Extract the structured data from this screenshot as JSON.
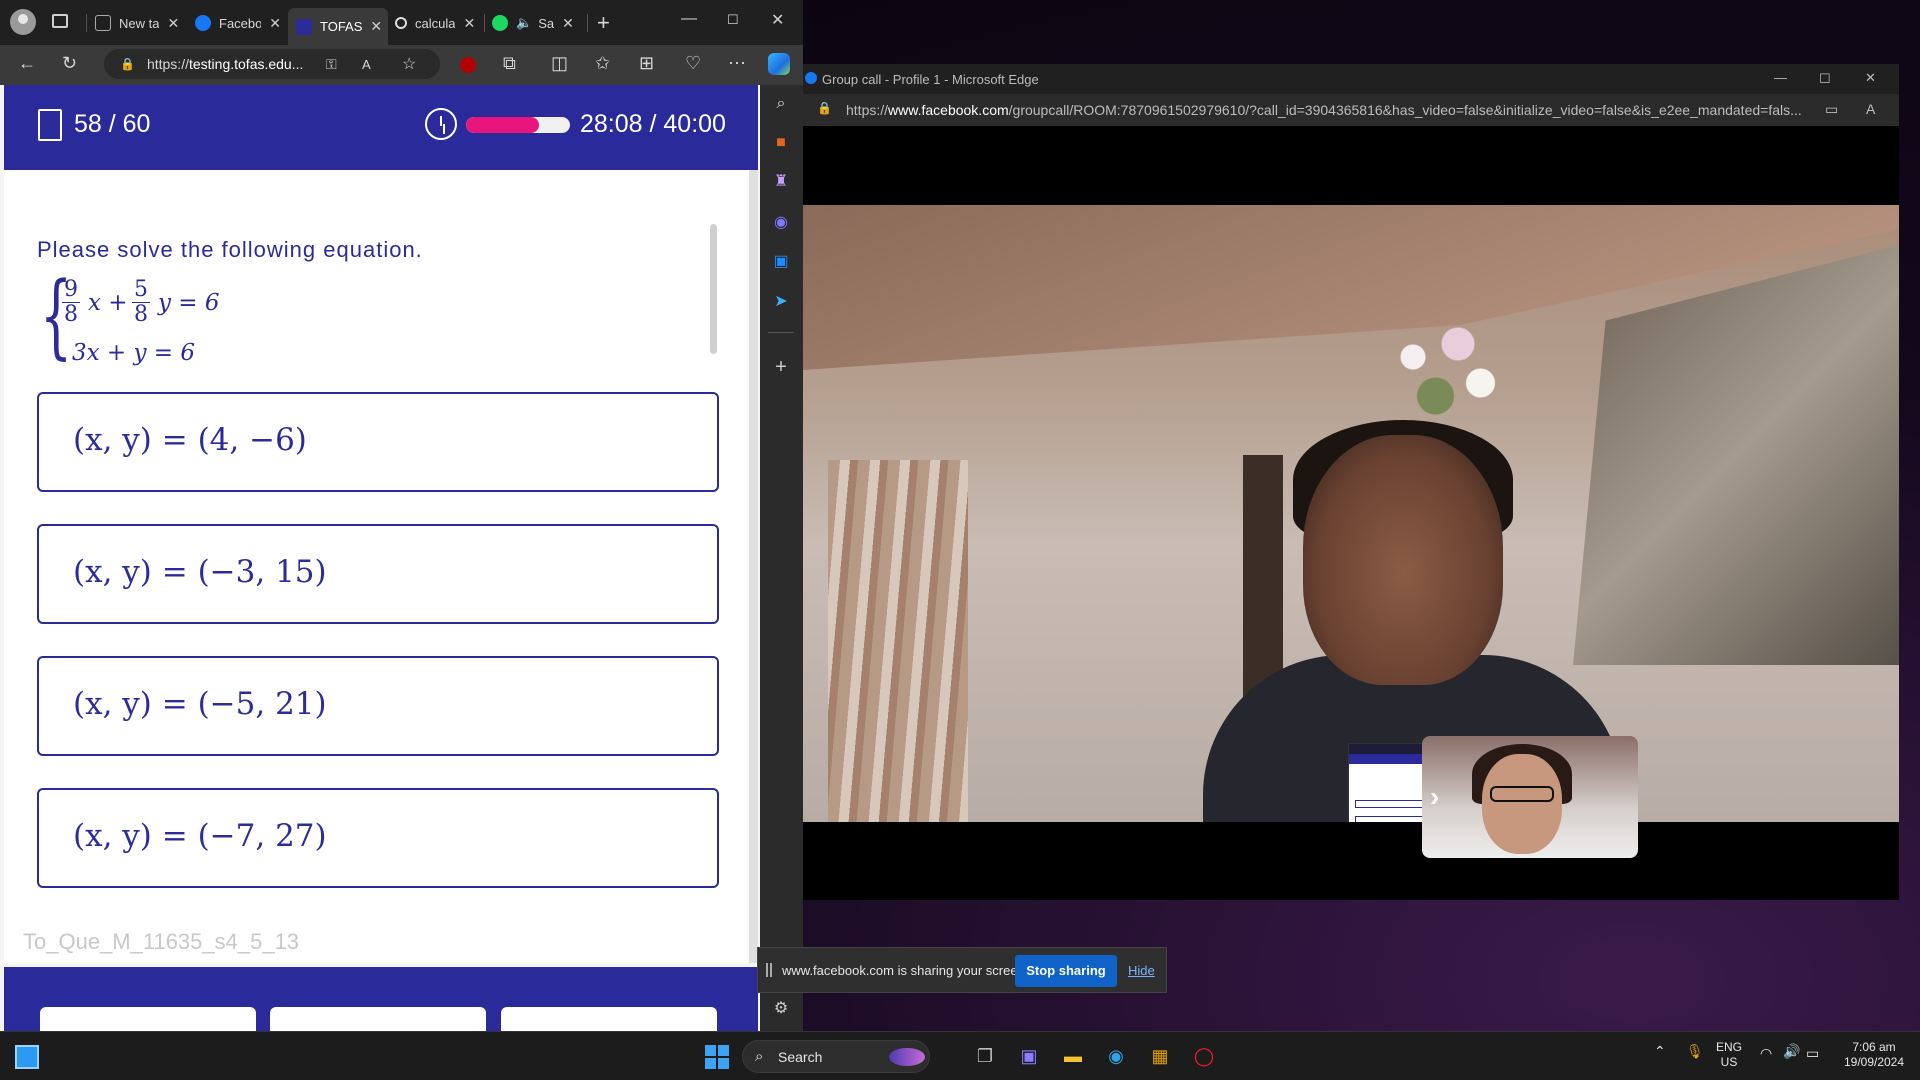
{
  "left_browser": {
    "tabs": [
      {
        "label": "New ta",
        "icon": "page-icon"
      },
      {
        "label": "Facebo",
        "icon": "facebook-icon"
      },
      {
        "label": "TOFAS",
        "icon": "tofas-icon",
        "active": true
      },
      {
        "label": "calcula",
        "icon": "search-icon"
      },
      {
        "label": "Sa",
        "icon": "spotify-icon"
      }
    ],
    "url_prefix": "https://",
    "url_host": "testing.tofas.edu..."
  },
  "quiz": {
    "question_count": "58 / 60",
    "timer": "28:08 / 40:00",
    "time_progress": 0.7,
    "prompt": "Please solve the following equation.",
    "equation": {
      "a_num": "9",
      "a_den": "8",
      "a_var": "x +",
      "b_num": "5",
      "b_den": "8",
      "b_var": "y = 6",
      "line2": "3x + y = 6"
    },
    "options": [
      "(x, y) = (4, −6)",
      "(x, y) = (−3, 15)",
      "(x, y) = (−5, 21)",
      "(x, y) = (−7, 27)"
    ],
    "question_id": "To_Que_M_11635_s4_5_13"
  },
  "call_window": {
    "title": "Group call - Profile 1 - Microsoft Edge",
    "url_prefix": "https://",
    "url_host": "www.facebook.com",
    "url_rest": "/groupcall/ROOM:7870961502979610/?call_id=3904365816&has_video=false&initialize_video=false&is_e2ee_mandated=fals..."
  },
  "share_bar": {
    "message": "www.facebook.com is sharing your screen.",
    "stop_label": "Stop sharing",
    "hide_label": "Hide"
  },
  "taskbar": {
    "search_label": "Search",
    "lang_top": "ENG",
    "lang_bottom": "US",
    "time": "7:06 am",
    "date": "19/09/2024"
  },
  "colors": {
    "quiz_blue": "#2a2a9a",
    "timer_pink": "#e8167c",
    "share_button": "#0f62c8"
  }
}
